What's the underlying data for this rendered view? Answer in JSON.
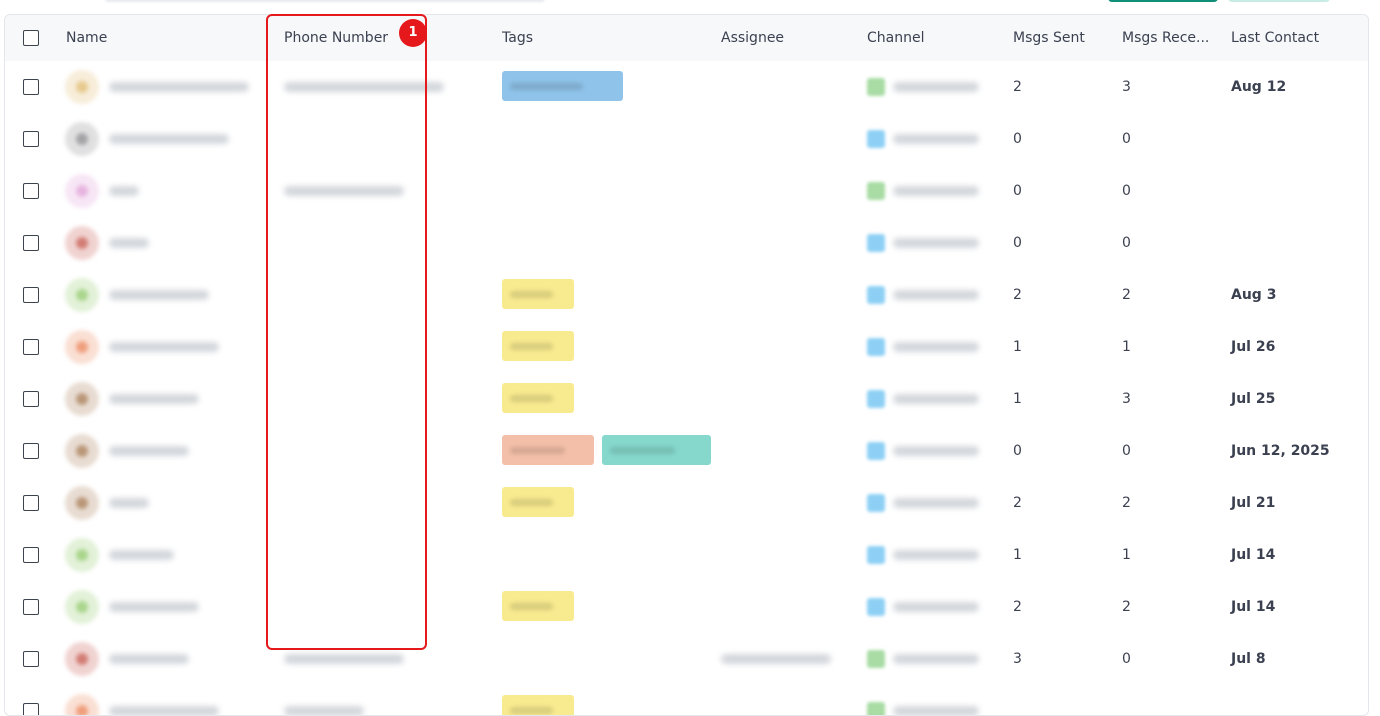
{
  "table": {
    "headers": {
      "name": "Name",
      "phone": "Phone Number",
      "tags": "Tags",
      "assignee": "Assignee",
      "channel": "Channel",
      "sent": "Msgs Sent",
      "received": "Msgs Rece...",
      "last_contact": "Last Contact"
    },
    "rows": [
      {
        "avatar_color": "#e7c98e",
        "has_phone": true,
        "tags": [
          {
            "color": "#8fc3e9"
          }
        ],
        "channel_color": "#a8dca4",
        "sent": "2",
        "received": "3",
        "last_contact": "Aug 12"
      },
      {
        "avatar_color": "#a3a3a6",
        "has_phone": false,
        "tags": [],
        "channel_color": "#8ed0f5",
        "sent": "0",
        "received": "0",
        "last_contact": ""
      },
      {
        "avatar_color": "#e7b4e0",
        "has_phone": true,
        "tags": [],
        "channel_color": "#a8dca4",
        "sent": "0",
        "received": "0",
        "last_contact": ""
      },
      {
        "avatar_color": "#d27c74",
        "has_phone": false,
        "tags": [],
        "channel_color": "#8ed0f5",
        "sent": "0",
        "received": "0",
        "last_contact": ""
      },
      {
        "avatar_color": "#a9d58b",
        "has_phone": false,
        "tags": [
          {
            "color": "#f7ea8f"
          }
        ],
        "channel_color": "#8ed0f5",
        "sent": "2",
        "received": "2",
        "last_contact": "Aug 3"
      },
      {
        "avatar_color": "#ef9e7c",
        "has_phone": false,
        "tags": [
          {
            "color": "#f7ea8f"
          }
        ],
        "channel_color": "#8ed0f5",
        "sent": "1",
        "received": "1",
        "last_contact": "Jul 26"
      },
      {
        "avatar_color": "#b99677",
        "has_phone": false,
        "tags": [
          {
            "color": "#f7ea8f"
          }
        ],
        "channel_color": "#8ed0f5",
        "sent": "1",
        "received": "3",
        "last_contact": "Jul 25"
      },
      {
        "avatar_color": "#b99677",
        "has_phone": false,
        "tags": [
          {
            "color": "#f3bfa8"
          },
          {
            "color": "#86d8cc"
          }
        ],
        "channel_color": "#8ed0f5",
        "sent": "0",
        "received": "0",
        "last_contact": "Jun 12, 2025"
      },
      {
        "avatar_color": "#b99677",
        "has_phone": false,
        "tags": [
          {
            "color": "#f7ea8f"
          }
        ],
        "channel_color": "#8ed0f5",
        "sent": "2",
        "received": "2",
        "last_contact": "Jul 21"
      },
      {
        "avatar_color": "#a9d58b",
        "has_phone": false,
        "tags": [],
        "channel_color": "#8ed0f5",
        "sent": "1",
        "received": "1",
        "last_contact": "Jul 14"
      },
      {
        "avatar_color": "#a9d58b",
        "has_phone": false,
        "tags": [
          {
            "color": "#f7ea8f"
          }
        ],
        "channel_color": "#8ed0f5",
        "sent": "2",
        "received": "2",
        "last_contact": "Jul 14"
      },
      {
        "avatar_color": "#d27c74",
        "has_phone": true,
        "tags": [],
        "channel_color": "#a8dca4",
        "sent": "3",
        "received": "0",
        "last_contact": "Jul 8",
        "has_assignee": true
      },
      {
        "avatar_color": "#ef9e7c",
        "has_phone": true,
        "tags": [
          {
            "color": "#f7ea8f"
          }
        ],
        "channel_color": "#a8dca4",
        "sent": "",
        "received": "",
        "last_contact": ""
      }
    ]
  },
  "annotation": {
    "marker_label": "1",
    "color": "#e5191c"
  }
}
